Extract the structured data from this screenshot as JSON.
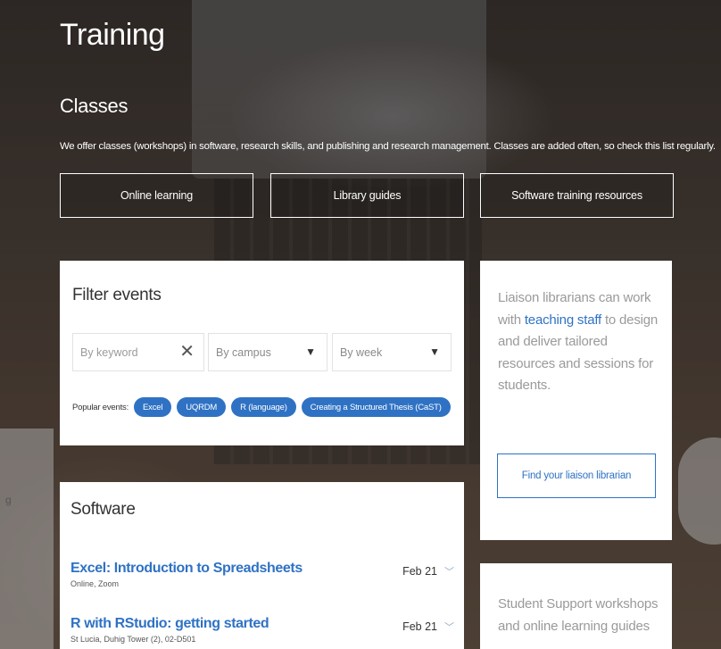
{
  "header": {
    "title": "Training",
    "section_title": "Classes",
    "intro": "We offer classes (workshops) in software, research skills, and publishing and research management. Classes are added often, so check this list regularly."
  },
  "hero_buttons": {
    "online": "Online learning",
    "guides": "Library guides",
    "software": "Software training resources"
  },
  "filter": {
    "title": "Filter events",
    "keyword_placeholder": "By keyword",
    "campus_value": "By campus",
    "week_value": "By week",
    "popular_label": "Popular events:",
    "chips": [
      "Excel",
      "UQRDM",
      "R (language)",
      "Creating a Structured Thesis (CaST)"
    ]
  },
  "software": {
    "title": "Software",
    "events": [
      {
        "title": "Excel: Introduction to Spreadsheets",
        "location": "Online, Zoom",
        "date": "Feb 21"
      },
      {
        "title": "R with RStudio: getting started",
        "location": "St Lucia, Duhig Tower (2), 02-D501",
        "date": "Feb 21"
      }
    ]
  },
  "liaison": {
    "text_before": "Liaison librarians can work with ",
    "link": "teaching staff",
    "text_after": " to design and deliver tailored resources and sessions for students.",
    "button": "Find your liaison librarian"
  },
  "support": {
    "text": "Student Support workshops and online learning guides"
  },
  "side_fragment": "g",
  "colors": {
    "accent": "#2f72c4"
  }
}
